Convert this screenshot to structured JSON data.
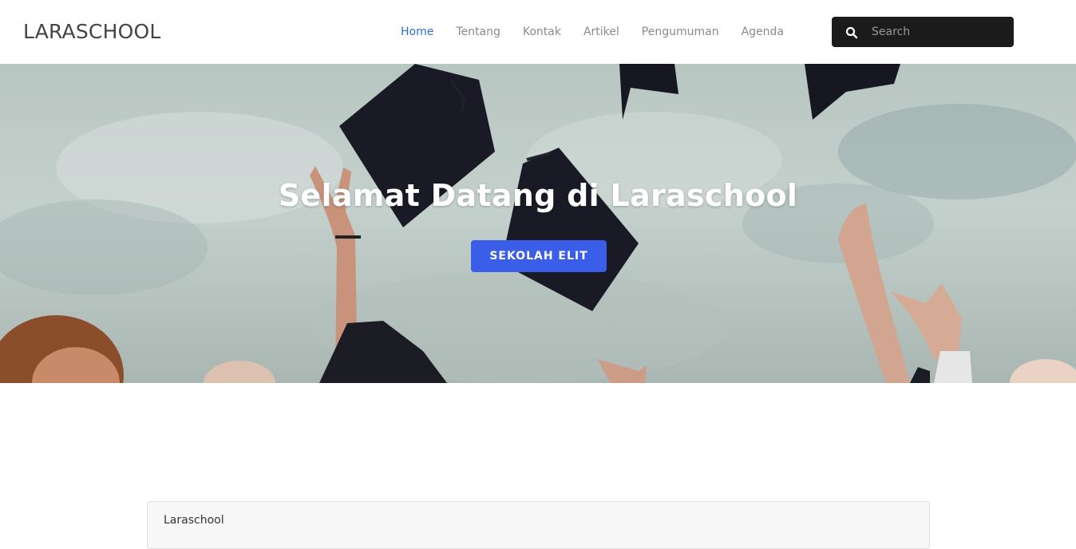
{
  "navbar": {
    "brand": "LARASCHOOL",
    "items": [
      {
        "label": "Home",
        "active": true
      },
      {
        "label": "Tentang",
        "active": false
      },
      {
        "label": "Kontak",
        "active": false
      },
      {
        "label": "Artikel",
        "active": false
      },
      {
        "label": "Pengumuman",
        "active": false
      },
      {
        "label": "Agenda",
        "active": false
      }
    ],
    "search": {
      "placeholder": "Search",
      "icon": "search-icon"
    }
  },
  "hero": {
    "title": "Selamat Datang di Laraschool",
    "button_label": "SEKOLAH ELIT"
  },
  "card": {
    "header": "Laraschool"
  },
  "colors": {
    "accent_link": "#2f6fd6",
    "button": "#3a5ee8",
    "search_bg": "#1b1b1b"
  }
}
